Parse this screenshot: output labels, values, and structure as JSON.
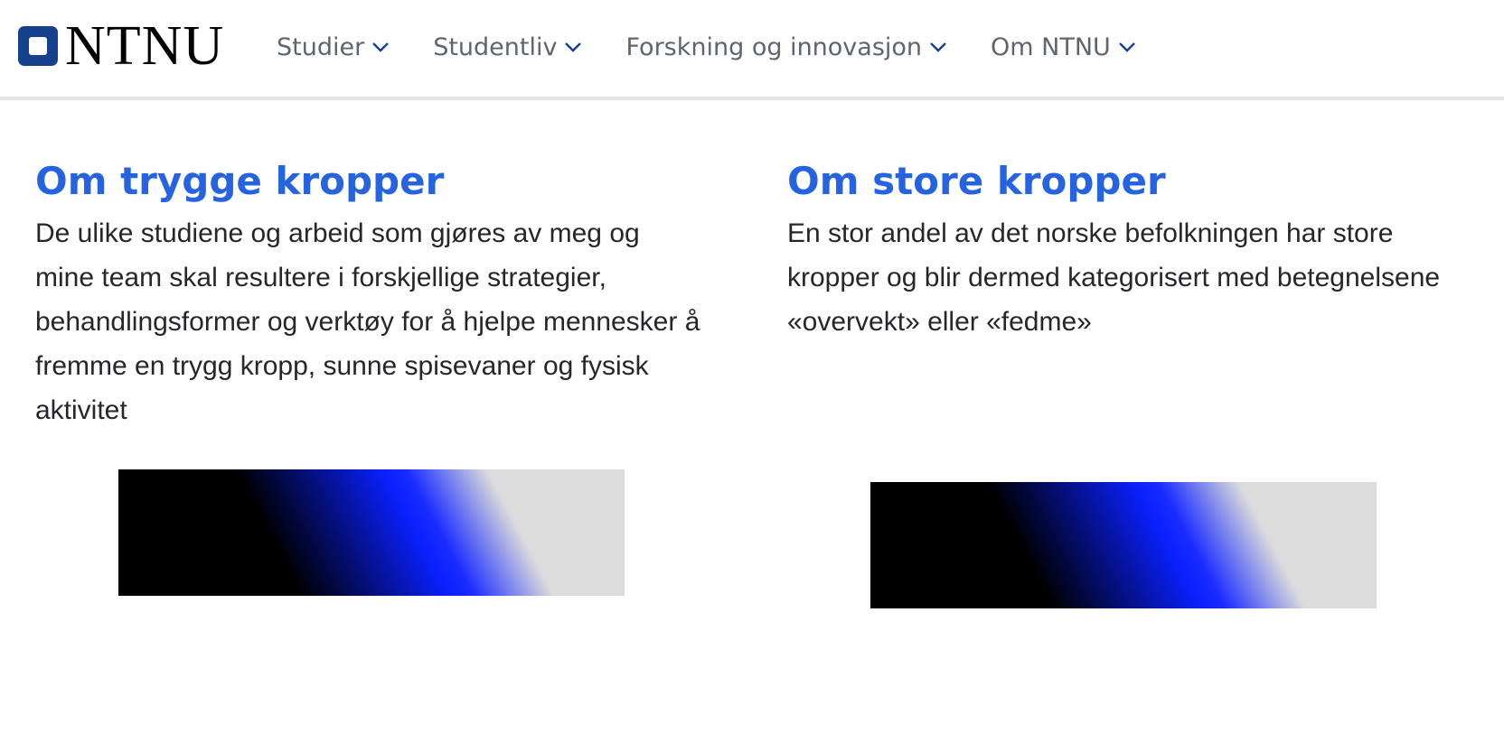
{
  "header": {
    "logo_text": "NTNU",
    "nav": [
      {
        "label": "Studier"
      },
      {
        "label": "Studentliv"
      },
      {
        "label": "Forskning og innovasjon"
      },
      {
        "label": "Om NTNU"
      }
    ]
  },
  "colors": {
    "brand": "#15418c",
    "heading": "#2563e0",
    "nav_text": "#5f6470",
    "body_text": "#26262b",
    "header_border": "#e4e4e4"
  },
  "sections": [
    {
      "title": "Om trygge kropper",
      "text": "De ulike studiene og arbeid som gjøres av meg og mine team skal resultere i forskjellige strategier, behandlingsformer og verktøy for å hjelpe mennesker å fremme en trygg kropp, sunne spisevaner og fysisk aktivitet"
    },
    {
      "title": "Om store kropper",
      "text": "En stor andel av det norske befolkningen har store kropper og blir dermed kategorisert med betegnelsene «overvekt» eller «fedme»"
    }
  ]
}
